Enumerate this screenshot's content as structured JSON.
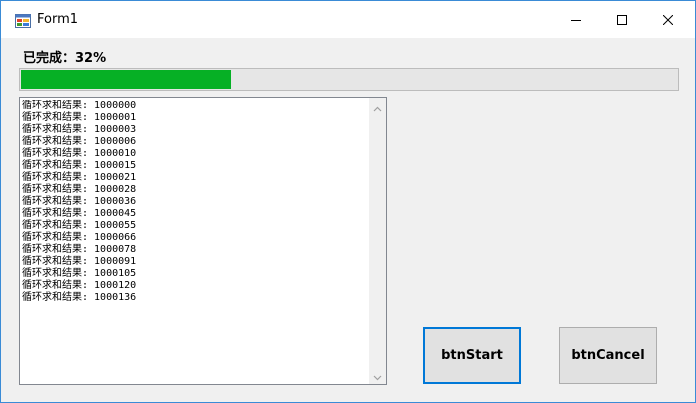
{
  "window": {
    "title": "Form1",
    "accent": "#0078d7"
  },
  "titlebar_icons": [
    "app-icon",
    "minimize-icon",
    "maximize-icon",
    "close-icon"
  ],
  "progress": {
    "label": "已完成：32%",
    "value": 0.32,
    "fill_color": "#06b025"
  },
  "log": {
    "lines": [
      "循环求和结果: 1000000",
      "循环求和结果: 1000001",
      "循环求和结果: 1000003",
      "循环求和结果: 1000006",
      "循环求和结果: 1000010",
      "循环求和结果: 1000015",
      "循环求和结果: 1000021",
      "循环求和结果: 1000028",
      "循环求和结果: 1000036",
      "循环求和结果: 1000045",
      "循环求和结果: 1000055",
      "循环求和结果: 1000066",
      "循环求和结果: 1000078",
      "循环求和结果: 1000091",
      "循环求和结果: 1000105",
      "循环求和结果: 1000120",
      "循环求和结果: 1000136"
    ]
  },
  "buttons": {
    "start_label": "btnStart",
    "cancel_label": "btnCancel"
  }
}
